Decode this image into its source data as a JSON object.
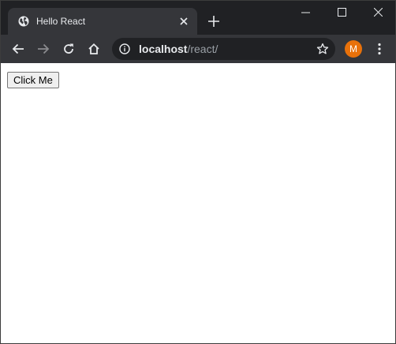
{
  "browser": {
    "tab": {
      "title": "Hello React",
      "favicon": "globe-icon",
      "close_icon": "close-icon"
    },
    "new_tab_icon": "plus-icon",
    "window_controls": [
      "minimize-icon",
      "maximize-icon",
      "close-icon"
    ],
    "toolbar": {
      "back_icon": "arrow-left-icon",
      "forward_icon": "arrow-right-icon",
      "reload_icon": "reload-icon",
      "home_icon": "home-icon",
      "site_info_icon": "info-icon",
      "url_host": "localhost",
      "url_path": "/react/",
      "bookmark_icon": "star-icon",
      "profile_initial": "M",
      "menu_icon": "kebab-menu-icon"
    },
    "colors": {
      "titlebar": "#202124",
      "toolbar": "#35363a",
      "omnibox": "#202124",
      "avatar": "#e8710a"
    }
  },
  "page": {
    "button_label": "Click Me"
  }
}
